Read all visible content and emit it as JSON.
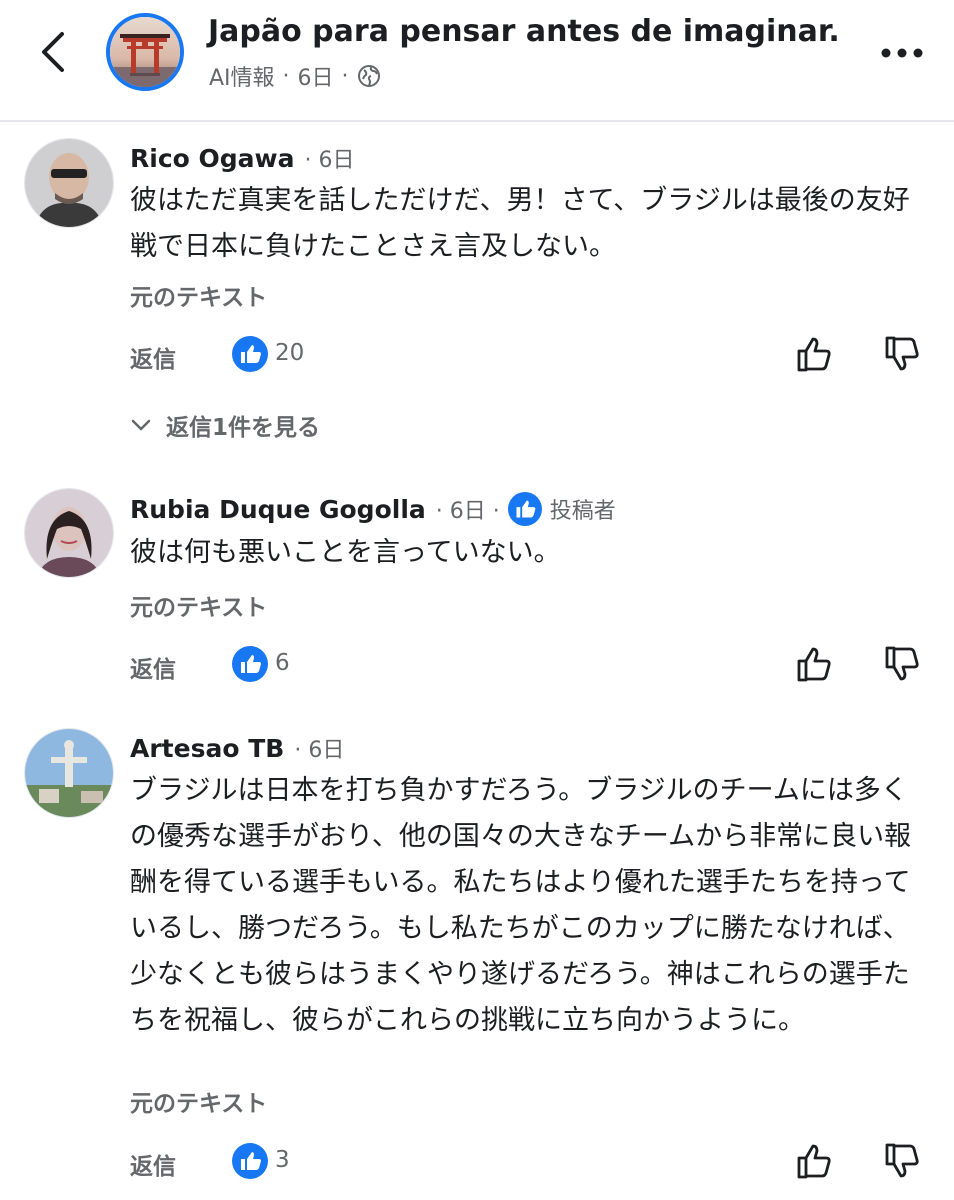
{
  "header": {
    "title": "Japão para pensar antes de imaginar.",
    "meta_label": "AI情報",
    "time": "6日",
    "dot": "·"
  },
  "comments": [
    {
      "author": "Rico Ogawa",
      "time": "6日",
      "text": "彼はただ真実を話しただけだ、男！さて、ブラジルは最後の友好戦で日本に負けたことさえ言及しない。",
      "see_original": "元のテキスト",
      "reply": "返信",
      "likes": "20",
      "view_replies": "返信1件を見る"
    },
    {
      "author": "Rubia Duque Gogolla",
      "time": "6日",
      "badge": "投稿者",
      "text": "彼は何も悪いことを言っていない。",
      "see_original": "元のテキスト",
      "reply": "返信",
      "likes": "6"
    },
    {
      "author": "Artesao TB",
      "time": "6日",
      "text": "ブラジルは日本を打ち負かすだろう。ブラジルのチームには多くの優秀な選手がおり、他の国々の大きなチームから非常に良い報酬を得ている選手もいる。私たちはより優れた選手たちを持っているし、勝つだろう。もし私たちがこのカップに勝たなければ、少なくとも彼らはうまくやり遂げるだろう。神はこれらの選手たちを祝福し、彼らがこれらの挑戦に立ち向かうように。",
      "see_original": "元のテキスト",
      "reply": "返信",
      "likes": "3"
    }
  ],
  "colors": {
    "accent": "#1877f2",
    "secondary_text": "#65676b",
    "primary_text": "#1c1e21"
  },
  "icons": [
    "back-arrow-icon",
    "globe-icon",
    "more-icon",
    "like-reaction-icon",
    "thumbs-up-icon",
    "thumbs-down-icon",
    "chevron-down-icon",
    "top-fan-badge-icon"
  ]
}
